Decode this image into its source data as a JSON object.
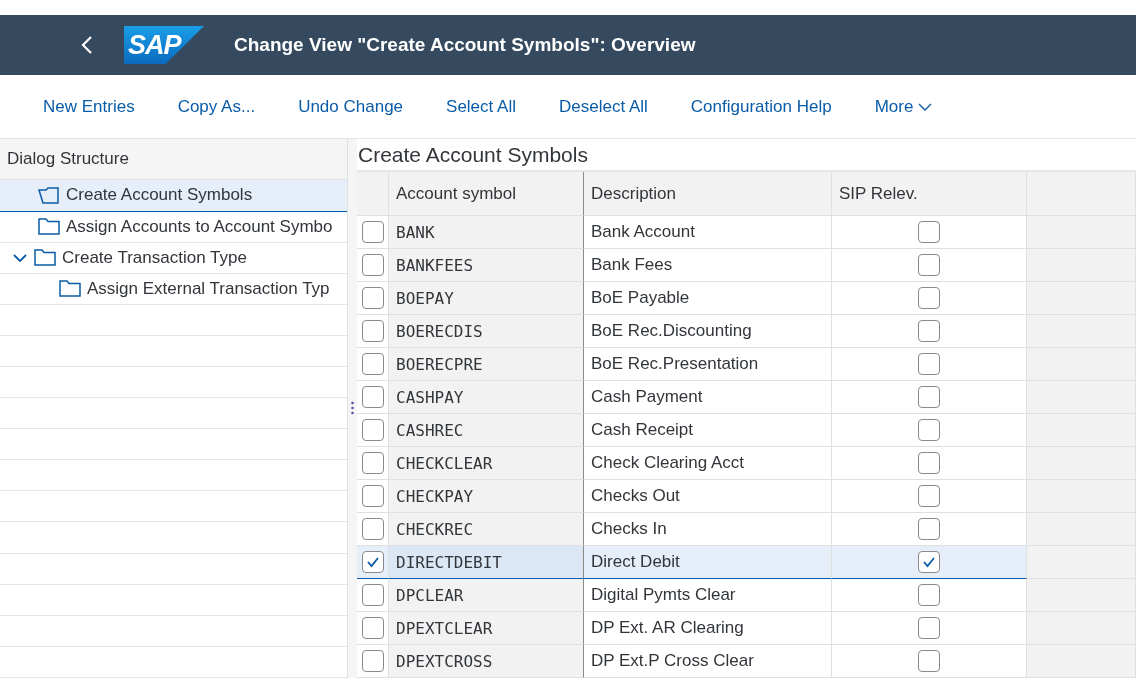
{
  "header": {
    "title": "Change View \"Create Account Symbols\": Overview",
    "logo": "SAP"
  },
  "toolbar": [
    "New Entries",
    "Copy As...",
    "Undo Change",
    "Select All",
    "Deselect All",
    "Configuration Help"
  ],
  "more": "More",
  "dialog_structure": {
    "title": "Dialog Structure",
    "items": [
      {
        "label": "Create Account Symbols",
        "selected": true
      },
      {
        "label": "Assign Accounts to Account Symbo",
        "selected": false
      },
      {
        "label": "Create Transaction Type",
        "selected": false,
        "expanded": true,
        "children": [
          {
            "label": "Assign External Transaction Typ",
            "selected": false
          }
        ]
      }
    ]
  },
  "table": {
    "title": "Create Account Symbols",
    "columns": [
      "Account symbol",
      "Description",
      "SIP Relev."
    ],
    "rows": [
      {
        "symbol": "BANK",
        "description": "Bank Account",
        "selected": false,
        "sip_relevant": false
      },
      {
        "symbol": "BANKFEES",
        "description": "Bank Fees",
        "selected": false,
        "sip_relevant": false
      },
      {
        "symbol": "BOEPAY",
        "description": "BoE Payable",
        "selected": false,
        "sip_relevant": false
      },
      {
        "symbol": "BOERECDIS",
        "description": "BoE Rec.Discounting",
        "selected": false,
        "sip_relevant": false
      },
      {
        "symbol": "BOERECPRE",
        "description": "BoE Rec.Presentation",
        "selected": false,
        "sip_relevant": false
      },
      {
        "symbol": "CASHPAY",
        "description": "Cash Payment",
        "selected": false,
        "sip_relevant": false
      },
      {
        "symbol": "CASHREC",
        "description": "Cash Receipt",
        "selected": false,
        "sip_relevant": false
      },
      {
        "symbol": "CHECKCLEAR",
        "description": "Check Clearing Acct",
        "selected": false,
        "sip_relevant": false
      },
      {
        "symbol": "CHECKPAY",
        "description": "Checks Out",
        "selected": false,
        "sip_relevant": false
      },
      {
        "symbol": "CHECKREC",
        "description": "Checks In",
        "selected": false,
        "sip_relevant": false
      },
      {
        "symbol": "DIRECTDEBIT",
        "description": "Direct Debit",
        "selected": true,
        "sip_relevant": true
      },
      {
        "symbol": "DPCLEAR",
        "description": "Digital Pymts Clear",
        "selected": false,
        "sip_relevant": false
      },
      {
        "symbol": "DPEXTCLEAR",
        "description": "DP Ext. AR Clearing",
        "selected": false,
        "sip_relevant": false
      },
      {
        "symbol": "DPEXTCROSS",
        "description": "DP Ext.P Cross Clear",
        "selected": false,
        "sip_relevant": false
      }
    ]
  }
}
